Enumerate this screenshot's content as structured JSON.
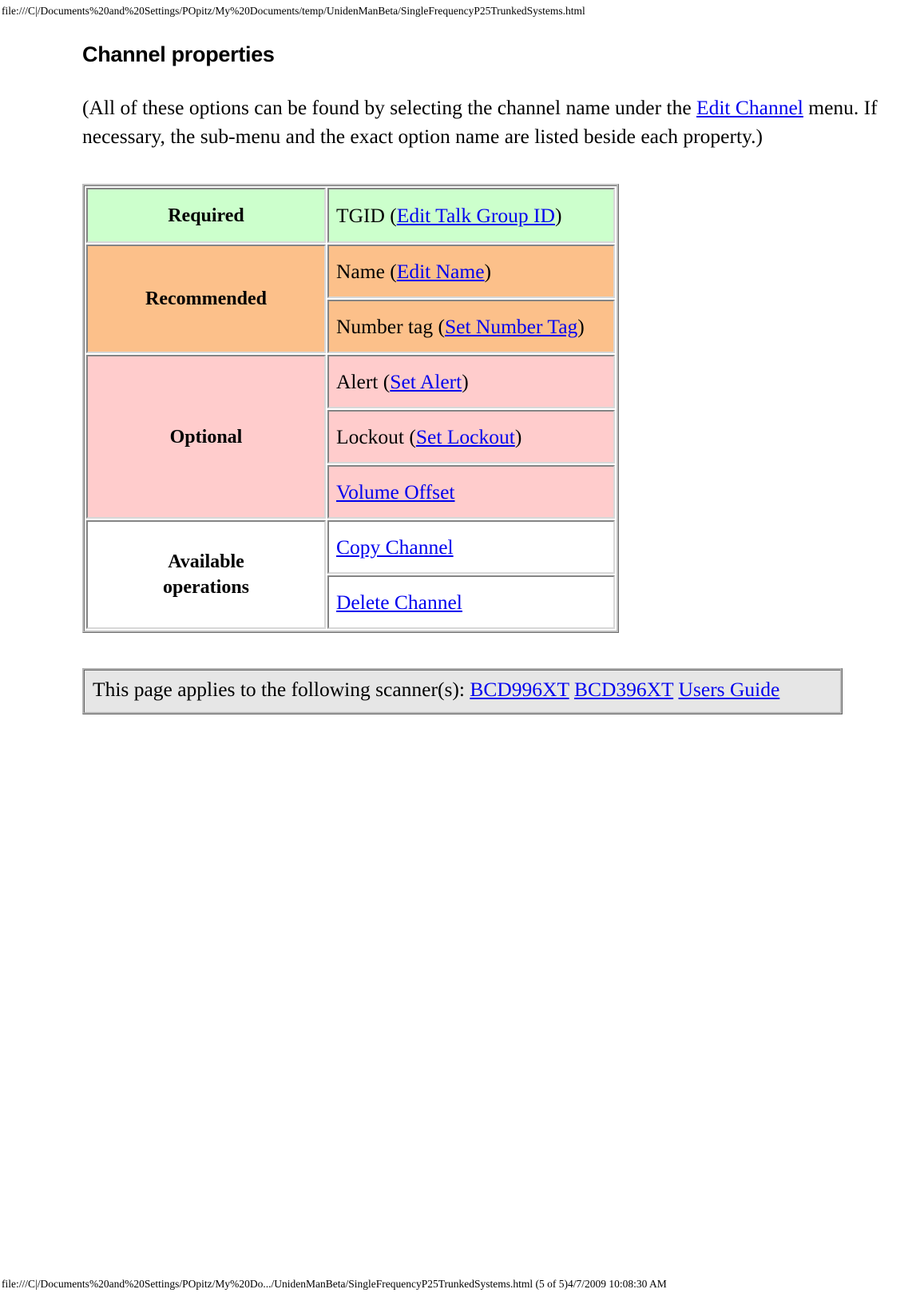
{
  "browser": {
    "header_url": "file:///C|/Documents%20and%20Settings/POpitz/My%20Documents/temp/UnidenManBeta/SingleFrequencyP25TrunkedSystems.html",
    "footer_text": "file:///C|/Documents%20and%20Settings/POpitz/My%20Do.../UnidenManBeta/SingleFrequencyP25TrunkedSystems.html (5 of 5)4/7/2009 10:08:30 AM"
  },
  "page": {
    "title": "Channel properties",
    "intro": {
      "before_link": "(All of these options can be found by selecting the channel name under the ",
      "link": "Edit Channel",
      "after_link": " menu. If necessary, the sub-menu and the exact option name are listed beside each property.)"
    }
  },
  "table": {
    "rows": [
      {
        "category": "Required",
        "color": "#ccffcc",
        "items": [
          {
            "prefix": "TGID (",
            "link": "Edit Talk Group ID",
            "suffix": ")"
          }
        ]
      },
      {
        "category": "Recommended",
        "color": "#fcc08a",
        "items": [
          {
            "prefix": "Name (",
            "link": "Edit Name",
            "suffix": ")"
          },
          {
            "prefix": "Number tag (",
            "link": "Set Number Tag",
            "suffix": ")"
          }
        ]
      },
      {
        "category": "Optional",
        "color": "#ffcccc",
        "items": [
          {
            "prefix": "Alert (",
            "link": "Set Alert",
            "suffix": ")"
          },
          {
            "prefix": "Lockout (",
            "link": "Set Lockout",
            "suffix": ")"
          },
          {
            "prefix": "",
            "link": "Volume Offset",
            "suffix": ""
          }
        ]
      },
      {
        "category": "Available operations",
        "color": "#ffffff",
        "items": [
          {
            "prefix": "",
            "link": "Copy Channel",
            "suffix": ""
          },
          {
            "prefix": "",
            "link": "Delete Channel",
            "suffix": ""
          }
        ]
      }
    ],
    "cells": {
      "required_label": "Required",
      "required_value_prefix": "TGID (",
      "required_value_link": "Edit Talk Group ID",
      "required_value_suffix": ")",
      "recommended_label": "Recommended",
      "name_prefix": "Name (",
      "name_link": "Edit Name",
      "name_suffix": ")",
      "numtag_prefix": "Number tag (",
      "numtag_link": "Set Number Tag",
      "numtag_suffix": ")",
      "optional_label": "Optional",
      "alert_prefix": "Alert (",
      "alert_link": "Set Alert",
      "alert_suffix": ")",
      "lockout_prefix": "Lockout (",
      "lockout_link": "Set Lockout",
      "lockout_suffix": ")",
      "volume_link": "Volume Offset",
      "operations_label_line1": "Available",
      "operations_label_line2": "operations",
      "copy_link": "Copy Channel",
      "delete_link": "Delete Channel"
    }
  },
  "applies_note": {
    "text_before": "This page applies to the following scanner(s): ",
    "links": [
      "BCD996XT",
      "BCD396XT",
      "Users Guide"
    ],
    "link1": "BCD996XT",
    "link2": "BCD396XT",
    "link3": "Users Guide"
  },
  "colors": {
    "link": "#0000ee",
    "required_bg": "#ccffcc",
    "recommended_bg": "#fcc08a",
    "optional_bg": "#ffcccc",
    "operations_bg": "#ffffff",
    "note_bg": "#e6e6e6"
  }
}
